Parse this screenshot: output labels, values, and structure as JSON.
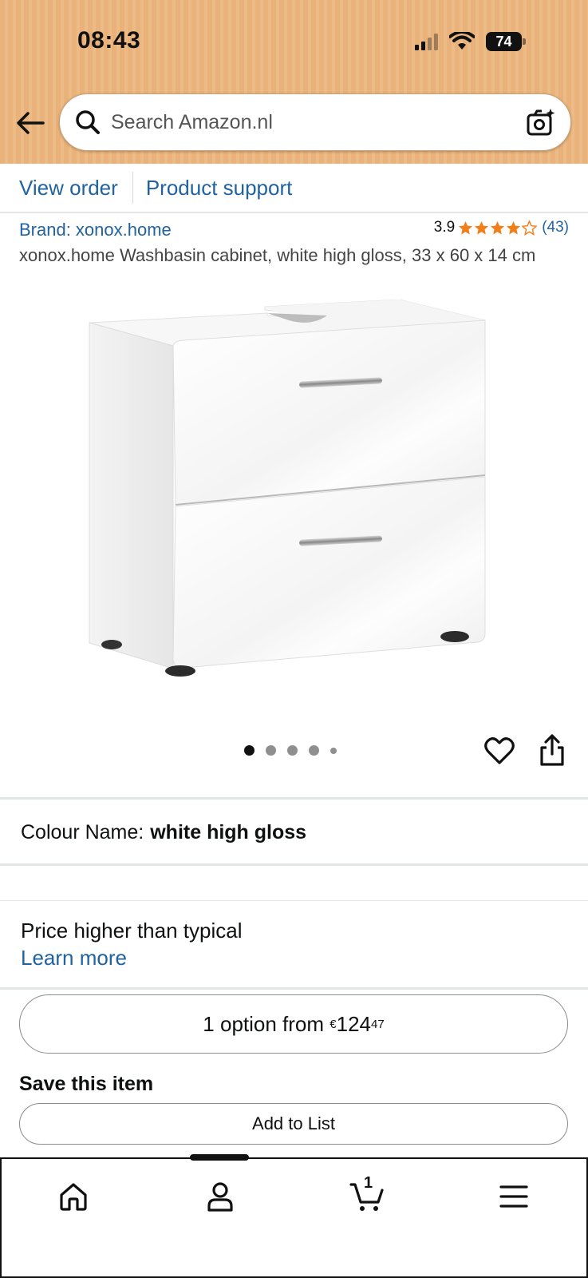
{
  "status": {
    "time": "08:43",
    "battery": "74"
  },
  "search": {
    "placeholder": "Search Amazon.nl"
  },
  "subnav": {
    "view_order": "View order",
    "product_support": "Product support"
  },
  "product": {
    "brand": "Brand: xonox.home",
    "rating_value": "3.9",
    "rating_count": "(43)",
    "stars": 3.9,
    "title": "xonox.home Washbasin cabinet, white high gloss, 33 x 60 x 14 cm",
    "image_count": 5,
    "active_image": 1
  },
  "colour": {
    "label": "Colour Name:",
    "value": "white high gloss"
  },
  "price": {
    "note": "Price higher than typical",
    "learn_more": "Learn more"
  },
  "options": {
    "prefix": "1 option from ",
    "currency": "€",
    "whole": "124",
    "fraction": "47"
  },
  "save": {
    "title": "Save this item",
    "add_to_list": "Add to List"
  },
  "bottom_nav": {
    "items": [
      "home-icon",
      "account-icon",
      "cart-icon",
      "menu-icon"
    ],
    "cart_count": "1"
  },
  "colors": {
    "header": "#e9b27a",
    "link": "#2162a1",
    "star": "#f07f1a"
  }
}
